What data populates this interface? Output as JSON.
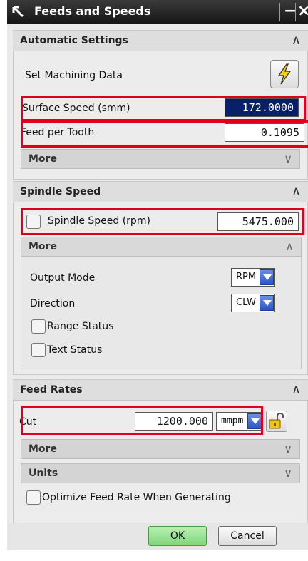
{
  "window": {
    "title": "Feeds and Speeds",
    "minimize_glyph": "−",
    "close_glyph": "×",
    "icon": "tool-arrow-icon"
  },
  "automatic_settings": {
    "header": "Automatic Settings",
    "set_machining_data_label": "Set Machining Data",
    "set_machining_data_icon": "lightning-icon",
    "surface_speed_label": "Surface Speed (smm)",
    "surface_speed_value": "172.0000",
    "feed_per_tooth_label": "Feed per Tooth",
    "feed_per_tooth_value": "0.1095",
    "more_label": "More"
  },
  "spindle_speed": {
    "header": "Spindle Speed",
    "spindle_speed_label": "Spindle Speed (rpm)",
    "spindle_speed_checked": false,
    "spindle_speed_value": "5475.000",
    "more_label": "More",
    "output_mode_label": "Output Mode",
    "output_mode_value": "RPM",
    "direction_label": "Direction",
    "direction_value": "CLW",
    "range_status_label": "Range Status",
    "range_status_checked": false,
    "text_status_label": "Text Status",
    "text_status_checked": false
  },
  "feed_rates": {
    "header": "Feed Rates",
    "cut_label": "Cut",
    "cut_value": "1200.000",
    "cut_units": "mmpm",
    "more_label": "More",
    "units_label": "Units",
    "optimize_label": "Optimize Feed Rate When Generating",
    "optimize_checked": false
  },
  "footer": {
    "ok_label": "OK",
    "cancel_label": "Cancel"
  },
  "colors": {
    "highlight": "#e0001b",
    "selected_field": "#0a1f6a",
    "ok_green": "#7fd67a"
  }
}
